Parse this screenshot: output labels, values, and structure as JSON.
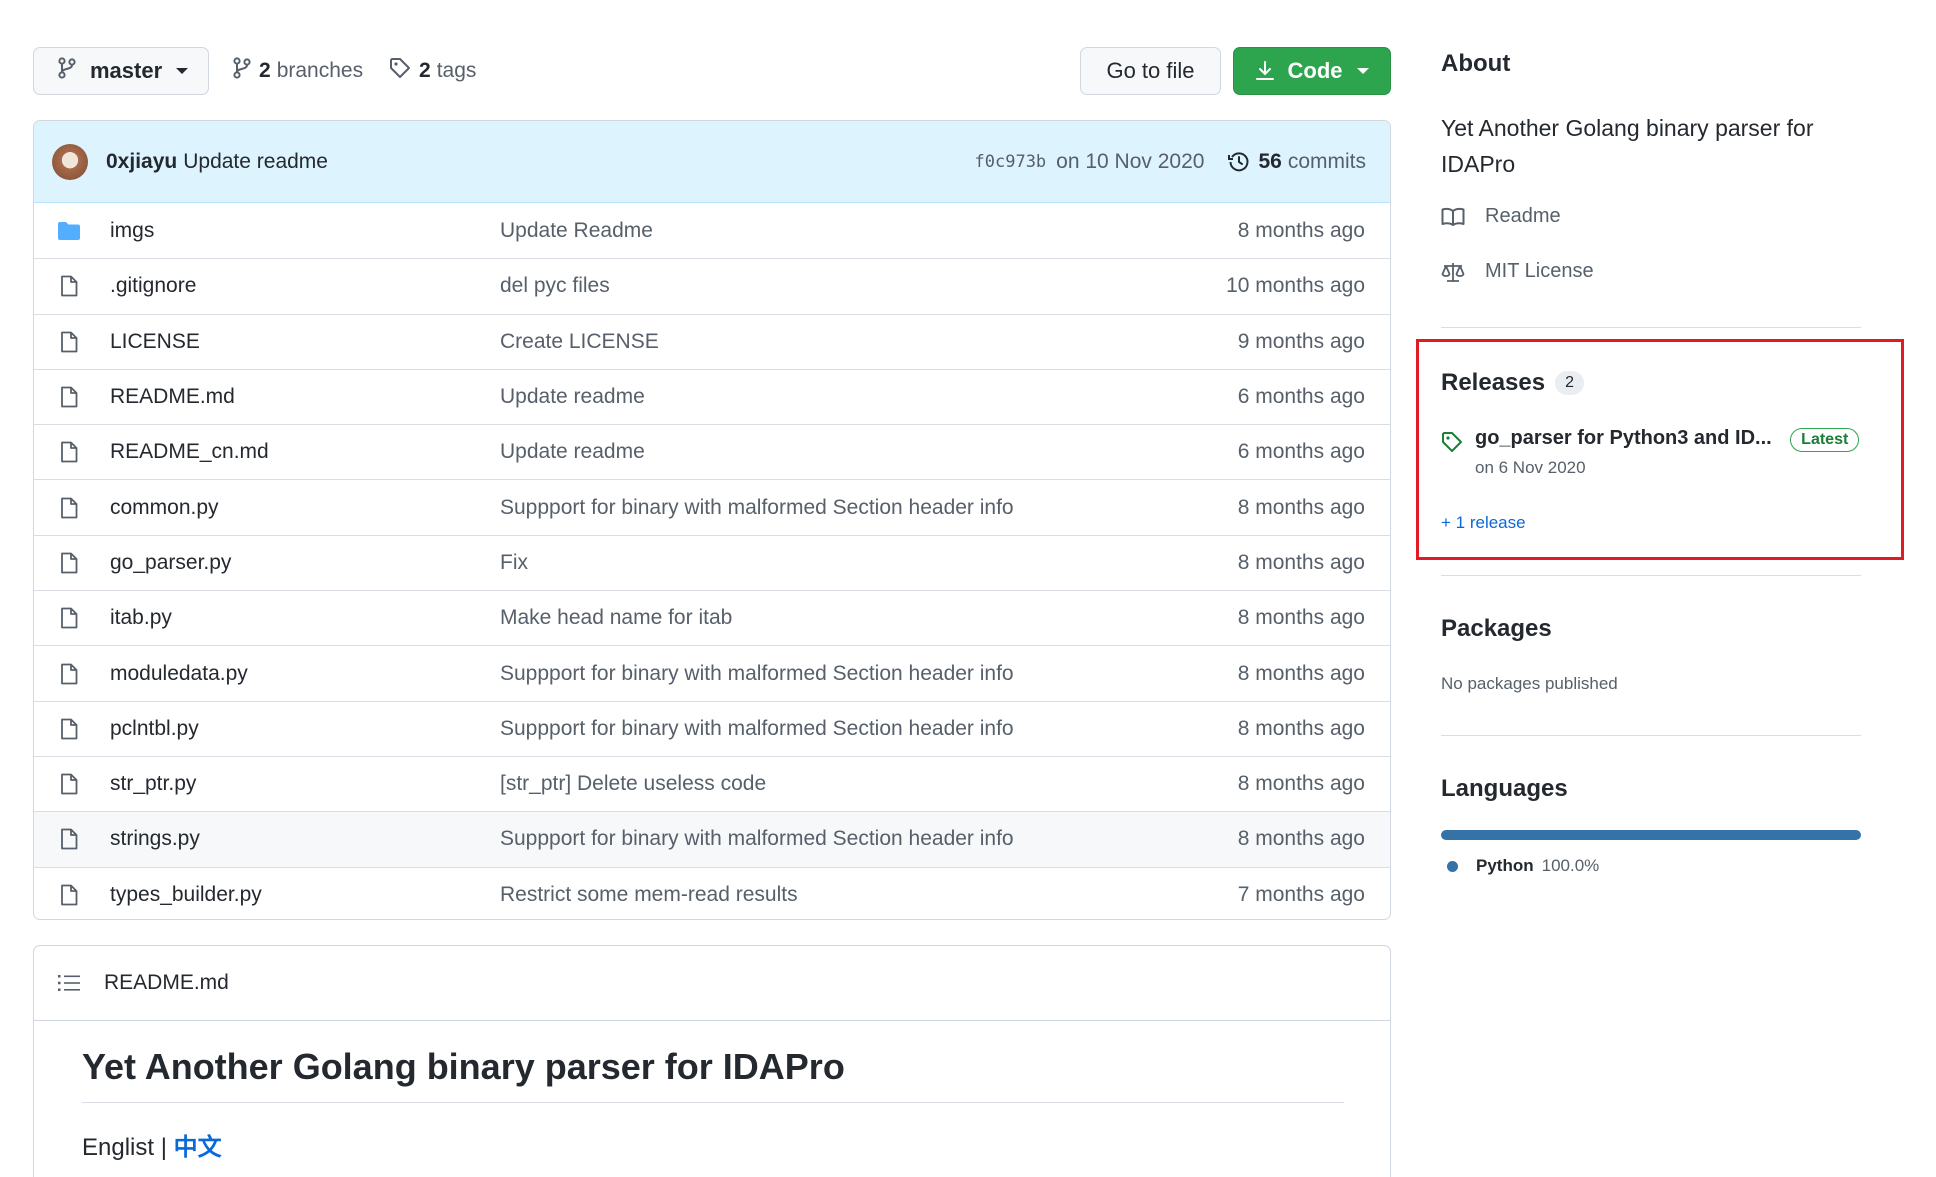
{
  "toolbar": {
    "branch_label": "master",
    "branches_count": "2",
    "branches_label": "branches",
    "tags_count": "2",
    "tags_label": "tags",
    "goto_file_label": "Go to file",
    "code_label": "Code"
  },
  "commit": {
    "author": "0xjiayu",
    "message": "Update readme",
    "sha": "f0c973b",
    "date": "on 10 Nov 2020",
    "commits_count": "56",
    "commits_label": "commits"
  },
  "files": [
    {
      "name": "imgs",
      "type": "folder",
      "message": "Update Readme",
      "age": "8 months ago"
    },
    {
      "name": ".gitignore",
      "type": "file",
      "message": "del pyc files",
      "age": "10 months ago"
    },
    {
      "name": "LICENSE",
      "type": "file",
      "message": "Create LICENSE",
      "age": "9 months ago"
    },
    {
      "name": "README.md",
      "type": "file",
      "message": "Update readme",
      "age": "6 months ago"
    },
    {
      "name": "README_cn.md",
      "type": "file",
      "message": "Update readme",
      "age": "6 months ago"
    },
    {
      "name": "common.py",
      "type": "file",
      "message": "Suppport for binary with malformed Section header info",
      "age": "8 months ago"
    },
    {
      "name": "go_parser.py",
      "type": "file",
      "message": "Fix",
      "age": "8 months ago"
    },
    {
      "name": "itab.py",
      "type": "file",
      "message": "Make head name for itab",
      "age": "8 months ago"
    },
    {
      "name": "moduledata.py",
      "type": "file",
      "message": "Suppport for binary with malformed Section header info",
      "age": "8 months ago"
    },
    {
      "name": "pclntbl.py",
      "type": "file",
      "message": "Suppport for binary with malformed Section header info",
      "age": "8 months ago"
    },
    {
      "name": "str_ptr.py",
      "type": "file",
      "message": "[str_ptr] Delete useless code",
      "age": "8 months ago"
    },
    {
      "name": "strings.py",
      "type": "file",
      "message": "Suppport for binary with malformed Section header info",
      "age": "8 months ago"
    },
    {
      "name": "types_builder.py",
      "type": "file",
      "message": "Restrict some mem-read results",
      "age": "7 months ago"
    }
  ],
  "readme": {
    "header": "README.md",
    "title": "Yet Another Golang binary parser for IDAPro",
    "lang_prefix": "Englist |",
    "lang_link": "中文"
  },
  "sidebar": {
    "about_title": "About",
    "about_desc": "Yet Another Golang binary parser for IDAPro",
    "readme_link": "Readme",
    "license_link": "MIT License",
    "releases_title": "Releases",
    "releases_count": "2",
    "release_name": "go_parser for Python3 and ID...",
    "release_badge": "Latest",
    "release_date": "on 6 Nov 2020",
    "more_releases": "+ 1 release",
    "packages_title": "Packages",
    "packages_empty": "No packages published",
    "languages_title": "Languages",
    "languages": [
      {
        "name": "Python",
        "percent": "100.0%",
        "color": "#3572A5"
      }
    ]
  },
  "colors": {
    "accent_green": "#2da44e",
    "link_blue": "#0969da",
    "highlight_red": "#e01b24",
    "python": "#3572A5"
  }
}
